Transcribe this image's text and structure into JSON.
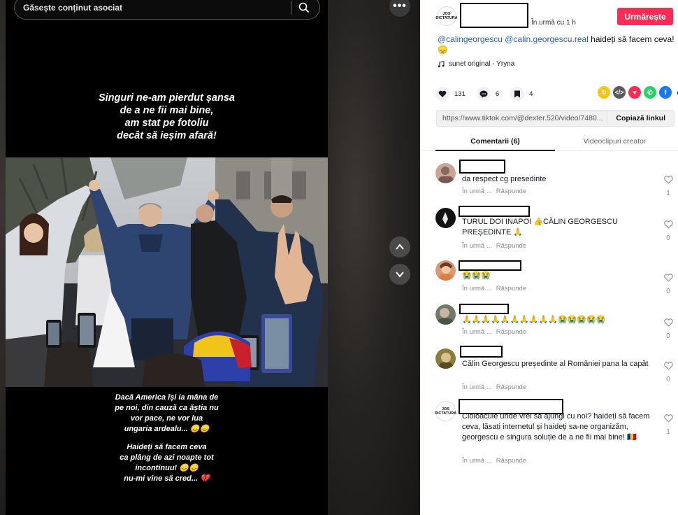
{
  "search": {
    "placeholder": "Găsește conținut asociat"
  },
  "video": {
    "caption_top": [
      "Singuri ne-am pierdut șansa",
      "de a ne fii mai bine,",
      "am stat pe fotoliu",
      "decât să ieșim afară!"
    ],
    "caption_bottom_1": [
      "Dacă America își ia mâna de",
      "pe noi, din cauză ca ăștia nu",
      "vor pace, ne vor lua",
      "ungaria ardealu... 😞😞"
    ],
    "caption_bottom_2": [
      "Haideți să facem ceva",
      "ca plâng de azi noapte tot",
      "incontinuu! 😞😞",
      "nu-mi vine să cred... 💔"
    ]
  },
  "post": {
    "avatar_text": [
      "JOS",
      "DICTATURA"
    ],
    "time": "În urmă cu 1 h",
    "follow_label": "Urmărește",
    "mention1": "@calingeorgescu",
    "mention2": "@calin.georgescu.real",
    "description": " haideți să facem ceva! 😞",
    "music": "sunet original - Yryna",
    "likes": "131",
    "comments": "6",
    "saves": "4",
    "url": "https://www.tiktok.com/@dexter.520/video/7480...",
    "copy_label": "Copiază linkul"
  },
  "tabs": {
    "comments": "Comentarii (6)",
    "creator": "Videoclipuri creator"
  },
  "colors": {
    "accent": "#fe2c55",
    "mention": "#2b5db9"
  },
  "comments": [
    {
      "text": "da respect cg presedinte",
      "time": "În urmă ...",
      "reply": "Răspunde",
      "likes": "1"
    },
    {
      "text": "TURUL DOI INAPOI 👍CĂLIN GEORGESCU PREȘEDINTE 🙏",
      "time": "În urmă ...",
      "reply": "Răspunde",
      "likes": "0"
    },
    {
      "text": "😭😭😭",
      "time": "În urmă ...",
      "reply": "Răspunde",
      "likes": "0"
    },
    {
      "text": "🙏🙏🙏🙏🙏🙏🙏🙏🙏🙏😭😭😭😭😭",
      "time": "În urmă ...",
      "reply": "Răspunde",
      "likes": "0"
    },
    {
      "text": "Călin Georgescu președinte al României pana la capăt",
      "time": "În urmă ...",
      "reply": "Răspunde",
      "likes": "0"
    },
    {
      "text": "Cioloacule unde vrei să ajungi cu noi? haideți să facem ceva, lăsați internetul și haideți sa-ne organizăm, georgescu e singura soluție de a ne fii mai bine! 🇷🇴",
      "time": "În urmă ...",
      "reply": "Răspunde",
      "likes": "1"
    }
  ]
}
